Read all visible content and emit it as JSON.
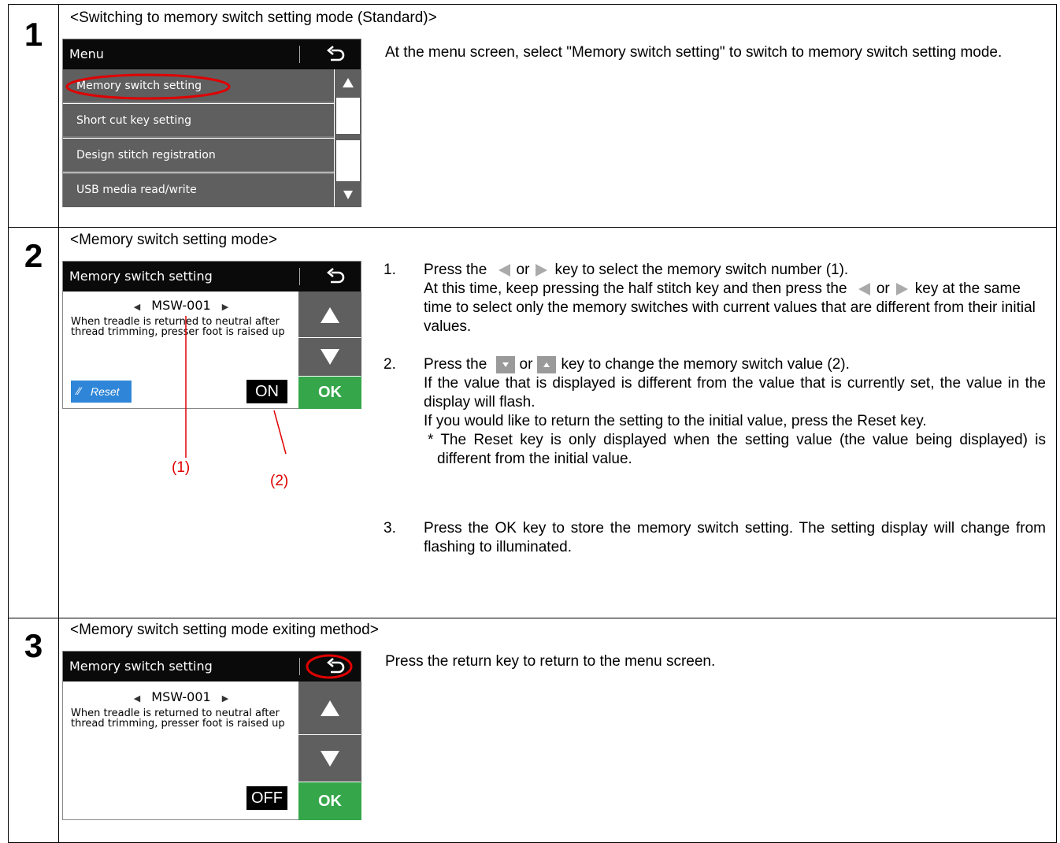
{
  "steps": [
    {
      "number": "1",
      "heading": "<Switching to memory switch setting mode (Standard)>",
      "panel": {
        "title": "Menu",
        "items": [
          "Memory switch setting",
          "Short cut key setting",
          "Design stitch registration",
          "USB media read/write"
        ]
      },
      "description": "At the menu screen, select \"Memory switch setting\" to switch to memory switch setting mode."
    },
    {
      "number": "2",
      "heading": "<Memory switch setting mode>",
      "panel": {
        "title": "Memory switch setting",
        "switch_number": "MSW-001",
        "switch_desc": "When treadle is returned to neutral after thread trimming, presser foot is raised up",
        "value": "ON",
        "reset_label": "Reset",
        "ok_label": "OK"
      },
      "callouts": [
        "(1)",
        "(2)"
      ],
      "instructions": [
        {
          "num": "1.",
          "p1_a": "Press the",
          "p1_or": "or",
          "p1_b": "key to select the memory switch number (1).",
          "p2_a": "At this time, keep pressing the half stitch key and then press the",
          "p2_or": "or",
          "p2_b": "key at the same time to select only the memory switches with current values that are different from their initial values."
        },
        {
          "num": "2.",
          "p1_a": "Press the",
          "p1_or": "or",
          "p1_b": "key to change the memory switch value (2).",
          "p2": "If the value that is displayed is different from the value that is currently set, the value in the display will flash.",
          "p3": "If you would like to return the setting to the initial value, press the Reset key.",
          "note": "* The Reset key is only displayed when the setting value (the value being displayed) is different from the initial value."
        },
        {
          "num": "3.",
          "text": "Press the OK key to store the memory switch setting. The setting display will change from flashing to illuminated."
        }
      ]
    },
    {
      "number": "3",
      "heading": "<Memory switch setting mode exiting method>",
      "panel": {
        "title": "Memory switch setting",
        "switch_number": "MSW-001",
        "switch_desc": "When treadle is returned to neutral after thread trimming, presser foot is raised up",
        "value": "OFF",
        "ok_label": "OK"
      },
      "description": "Press the return key to return to the menu screen."
    }
  ],
  "colors": {
    "annotation": "#e00000",
    "ok_green": "#35a64a",
    "reset_blue": "#2f86d8",
    "panel_grey": "#5f5f5f"
  }
}
